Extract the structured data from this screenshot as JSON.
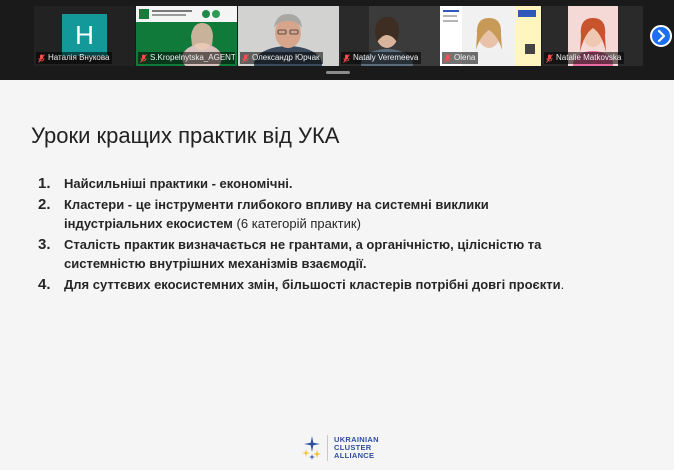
{
  "participants": [
    {
      "name": "Наталія Внукова",
      "avatar_letter": "H",
      "video": false,
      "mic_muted": true
    },
    {
      "name": "S.Kropelnytska_AGENT...",
      "video": true,
      "mic_muted": true
    },
    {
      "name": "Олександр Юрчак",
      "video": true,
      "mic_muted": true,
      "active": true
    },
    {
      "name": "Nataly Veremeeva",
      "video": true,
      "mic_muted": true
    },
    {
      "name": "Olena",
      "video": true,
      "mic_muted": true
    },
    {
      "name": "Natalie Matkovska",
      "video": true,
      "mic_muted": true
    }
  ],
  "next_button_icon": "chevron-right-icon",
  "slide": {
    "title": "Уроки кращих практик від УКА",
    "items": [
      {
        "num": "1.",
        "text": "Найсильніші практики - економічні.",
        "suffix": ""
      },
      {
        "num": "2.",
        "text": "Кластери - це інструменти глибокого впливу на системні виклики індустріальних екосистем",
        "suffix": " (6 категорій практик)"
      },
      {
        "num": "3.",
        "text": "Сталість практик визначається не грантами, а органічністю, цілісністю та системністю внутрішних механізмів взаємодії.",
        "suffix": ""
      },
      {
        "num": "4.",
        "text": "Для суттєвих екосистемних змін, більшості кластерів потрібні довгі проєкти",
        "suffix": "."
      }
    ],
    "logo": {
      "line1": "UKRAINIAN",
      "line2": "CLUSTER",
      "line3": "ALLIANCE"
    }
  },
  "colors": {
    "active_speaker_border": "#3fd27c",
    "next_button": "#1d6ff2",
    "avatar_teal": "#14999b",
    "logo_blue": "#2d4f9e",
    "logo_yellow": "#f2c230"
  }
}
